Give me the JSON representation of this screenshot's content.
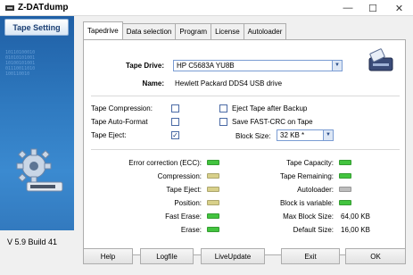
{
  "window": {
    "title": "Z-DATdump",
    "minimize": "—",
    "maximize": "☐",
    "close": "✕"
  },
  "sidebar": {
    "tape_setting_label": "Tape Setting",
    "version": "V 5.9 Build 41",
    "binary_text": "10110100010\n01010101001\n10100101001\n01110011010\n100110010"
  },
  "tabs": [
    "Tapedrive",
    "Data selection",
    "Program",
    "License",
    "Autoloader"
  ],
  "tapedrive": {
    "tape_drive_label": "Tape Drive:",
    "tape_drive_value": "HP C5683A YU8B",
    "name_label": "Name:",
    "name_value": "Hewlett Packard DDS4 USB drive",
    "options_left": [
      {
        "label": "Tape Compression:",
        "checked": false
      },
      {
        "label": "Tape Auto-Format",
        "checked": false
      },
      {
        "label": "Tape Eject:",
        "checked": true
      }
    ],
    "options_right": [
      {
        "label": "Eject Tape after Backup",
        "checked": false
      },
      {
        "label": "Save FAST-CRC on Tape",
        "checked": false
      }
    ],
    "block_size_label": "Block Size:",
    "block_size_value": "32 KB *",
    "status_left": [
      {
        "label": "Error correction (ECC):",
        "color": "#43c43f"
      },
      {
        "label": "Compression:",
        "color": "#d8d08a"
      },
      {
        "label": "Tape Eject:",
        "color": "#d8d08a"
      },
      {
        "label": "Position:",
        "color": "#d8d08a"
      },
      {
        "label": "Fast Erase:",
        "color": "#43c43f"
      },
      {
        "label": "Erase:",
        "color": "#43c43f"
      }
    ],
    "status_right": [
      {
        "label": "Tape Capacity:",
        "type": "led",
        "color": "#43c43f"
      },
      {
        "label": "Tape Remaining:",
        "type": "led",
        "color": "#43c43f"
      },
      {
        "label": "Autoloader:",
        "type": "led",
        "color": "#bdbdbd"
      },
      {
        "label": "Block is variable:",
        "type": "led",
        "color": "#43c43f"
      },
      {
        "label": "Max Block Size:",
        "type": "value",
        "value": "64,00 KB"
      },
      {
        "label": "Default Size:",
        "type": "value",
        "value": "16,00 KB"
      }
    ]
  },
  "buttons": {
    "help": "Help",
    "logfile": "Logfile",
    "liveupdate": "LiveUpdate",
    "exit": "Exit",
    "ok": "OK"
  }
}
